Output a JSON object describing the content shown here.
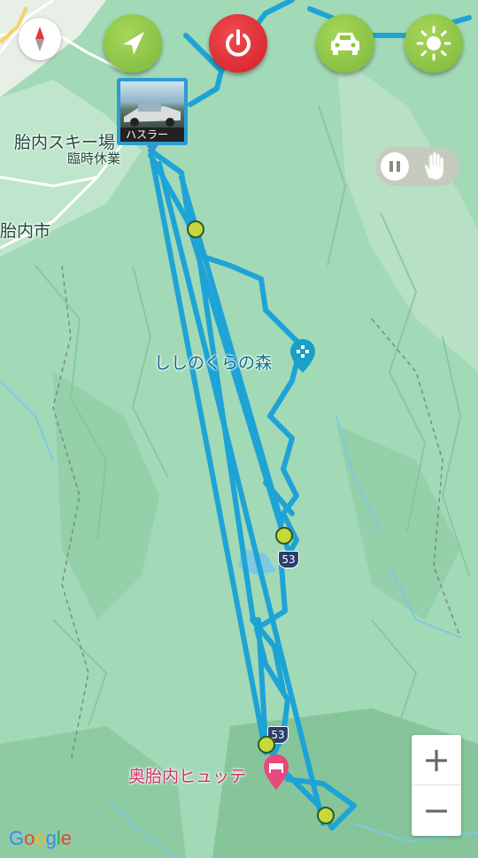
{
  "map": {
    "labels": {
      "ski": "胎内スキー場",
      "ski_status": "臨時休業",
      "city": "胎内市",
      "forest": "ししのくらの森",
      "hutte": "奥胎内ヒュッテ"
    },
    "road_shields": [
      "53",
      "53"
    ],
    "photo_caption": "ハスラー",
    "zoom_in": "+",
    "zoom_out": "−",
    "attribution": "Google"
  },
  "toolbar": {
    "buttons": [
      {
        "name": "navigate-button",
        "icon": "navigation-arrow-icon",
        "color": "#8cc63f"
      },
      {
        "name": "power-button",
        "icon": "power-icon",
        "color": "#e8262e"
      },
      {
        "name": "car-button",
        "icon": "car-icon",
        "color": "#8cc63f"
      },
      {
        "name": "brightness-button",
        "icon": "sun-icon",
        "color": "#8cc63f"
      }
    ]
  },
  "colors": {
    "route": "#1ea3d6",
    "map_green": "#9fd8b4",
    "waypoint": "#c6d83a"
  }
}
